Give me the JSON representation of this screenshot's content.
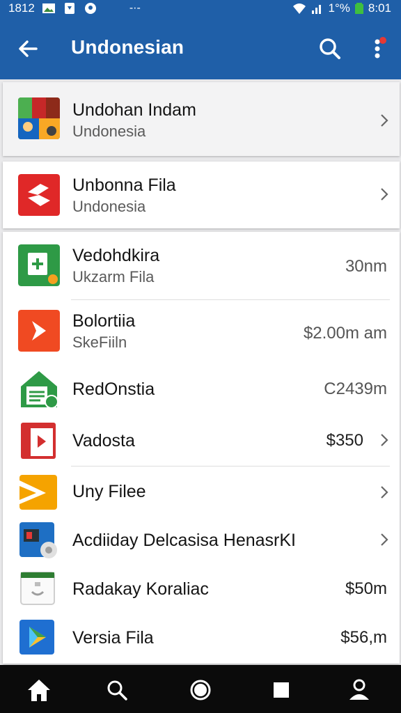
{
  "status_bar": {
    "time_left": "1812",
    "battery_text": "1°%",
    "time_right": "8:01",
    "icons": [
      "image-icon",
      "shield-icon",
      "location-icon",
      "wifi-icon",
      "signal-icon",
      "battery-icon"
    ]
  },
  "app_bar": {
    "title": "Undonesian",
    "icons": [
      "back-arrow-icon",
      "search-icon",
      "more-vert-icon"
    ],
    "notification_dot_color": "#e53935"
  },
  "colors": {
    "primary": "#1f5fa8",
    "nav_bg": "#0b0b0b",
    "background": "#e9e9eb"
  },
  "items": [
    {
      "title": "Undohan Indam",
      "subtitle": "Undonesia",
      "price": "",
      "icon": "photo-collage-icon",
      "trailing": "chevron"
    },
    {
      "title": "Unbonna Fila",
      "subtitle": "Undonesia",
      "price": "",
      "icon": "red-logo-icon",
      "trailing": "chevron"
    },
    {
      "title": "Vedohdkira",
      "subtitle": "Ukzarm Fila",
      "price": "30nm",
      "icon": "green-add-file-icon",
      "trailing": "price"
    },
    {
      "title": "Bolortiia",
      "subtitle": "SkeFiiln",
      "price": "$2.00m am",
      "icon": "orange-play-icon",
      "trailing": "price"
    },
    {
      "title": "RedOnstia",
      "subtitle": "",
      "price": "C2439m",
      "icon": "green-house-icon",
      "trailing": "price"
    },
    {
      "title": "Vadosta",
      "subtitle": "",
      "price": "$350",
      "icon": "red-document-icon",
      "trailing": "price-chevron"
    },
    {
      "title": "Uny Filee",
      "subtitle": "",
      "price": "",
      "icon": "yellow-envelope-icon",
      "trailing": "chevron"
    },
    {
      "title": "Acdiiday Delcasisa HenasrKI",
      "subtitle": "",
      "price": "",
      "icon": "photo-card-icon",
      "trailing": "chevron"
    },
    {
      "title": "Radakay Koraliac",
      "subtitle": "",
      "price": "$50m",
      "icon": "calendar-box-icon",
      "trailing": "price"
    },
    {
      "title": "Versia Fila",
      "subtitle": "",
      "price": "$56,m",
      "icon": "play-store-icon",
      "trailing": "price"
    }
  ],
  "nav_bar": {
    "icons": [
      "home-icon",
      "search-icon",
      "circle-icon",
      "square-icon",
      "person-icon"
    ]
  }
}
